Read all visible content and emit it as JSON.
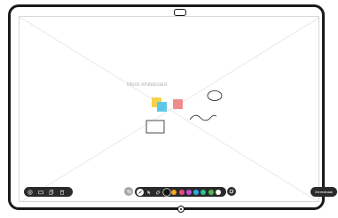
{
  "whiteboard": {
    "label": "Mock whiteboard",
    "sticky_colors": [
      "#f6d34a",
      "#5fc8e8",
      "#f28b8b"
    ]
  },
  "file_toolbar": {
    "icons": [
      "new-page-icon",
      "pages-icon",
      "copy-icon",
      "delete-icon"
    ]
  },
  "drawing_toolbar": {
    "undo_icon": "undo-icon",
    "tools": [
      "pen-icon",
      "selection-icon",
      "eraser-icon"
    ],
    "active_tool": "pen-icon",
    "colors": [
      "#111111",
      "#f5a623",
      "#e84a8a",
      "#c14fd1",
      "#2ea9e6",
      "#2fbf9b",
      "#49c04a",
      "#ffffff"
    ],
    "selected_color": "#111111",
    "sticky_note_icon": "sticky-note-icon"
  },
  "finish_button": {
    "label": "Gereedmaak"
  },
  "colors": {
    "bezel": "#1a1a1a",
    "toolbar": "#2a2a2a",
    "guide_lines": "#e3e3e3",
    "canvas": "#ffffff"
  }
}
